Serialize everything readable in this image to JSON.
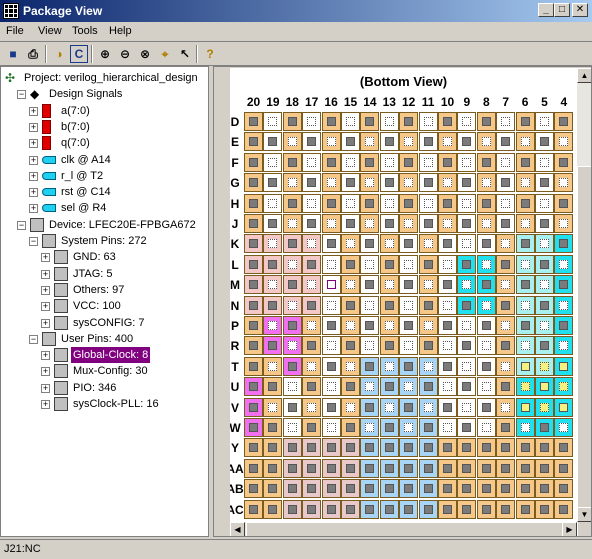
{
  "window": {
    "title": "Package View",
    "minimize_glyph": "_",
    "maximize_glyph": "□",
    "close_glyph": "✕"
  },
  "menu": [
    "File",
    "View",
    "Tools",
    "Help"
  ],
  "toolbar_icons": [
    "save-icon",
    "print-icon",
    "properties-icon",
    "refresh-icon",
    "zoom-in-icon",
    "zoom-out-icon",
    "zoom-fit-icon",
    "find-icon",
    "pointer-icon",
    "help-icon"
  ],
  "toolbar_glyphs": {
    "save-icon": "■",
    "print-icon": "⎙",
    "properties-icon": "◑",
    "refresh-icon": "C",
    "zoom-in-icon": "⊕",
    "zoom-out-icon": "⊖",
    "zoom-fit-icon": "⊗",
    "find-icon": "⌖",
    "pointer-icon": "↖",
    "help-icon": "?"
  },
  "tree": [
    {
      "label": "Project: verilog_hierarchical_design",
      "level": 0,
      "icon": "project-icon",
      "exp": ""
    },
    {
      "label": "Design Signals",
      "level": 1,
      "icon": "signals-icon",
      "exp": "−"
    },
    {
      "label": "a(7:0)",
      "level": 2,
      "icon": "bus-icon",
      "exp": "+"
    },
    {
      "label": "b(7:0)",
      "level": 2,
      "icon": "bus-icon",
      "exp": "+"
    },
    {
      "label": "q(7:0)",
      "level": 2,
      "icon": "bus-icon",
      "exp": "+"
    },
    {
      "label": "clk @ A14",
      "level": 2,
      "icon": "pin-icon",
      "exp": "+"
    },
    {
      "label": "r_l @ T2",
      "level": 2,
      "icon": "pin-icon",
      "exp": "+"
    },
    {
      "label": "rst @ C14",
      "level": 2,
      "icon": "pin-icon",
      "exp": "+"
    },
    {
      "label": "sel @ R4",
      "level": 2,
      "icon": "pin-icon",
      "exp": "+"
    },
    {
      "label": "Device: LFEC20E-FPBGA672",
      "level": 1,
      "icon": "chip-icon",
      "exp": "−"
    },
    {
      "label": "System Pins: 272",
      "level": 2,
      "icon": "chip-icon",
      "exp": "−"
    },
    {
      "label": "GND: 63",
      "level": 3,
      "icon": "chip-icon",
      "exp": "+"
    },
    {
      "label": "JTAG: 5",
      "level": 3,
      "icon": "chip-icon",
      "exp": "+"
    },
    {
      "label": "Others: 97",
      "level": 3,
      "icon": "chip-icon",
      "exp": "+"
    },
    {
      "label": "VCC: 100",
      "level": 3,
      "icon": "chip-icon",
      "exp": "+"
    },
    {
      "label": "sysCONFIG: 7",
      "level": 3,
      "icon": "chip-icon",
      "exp": "+"
    },
    {
      "label": "User Pins: 400",
      "level": 2,
      "icon": "chip-icon",
      "exp": "−"
    },
    {
      "label": "Global-Clock: 8",
      "level": 3,
      "icon": "chip-icon",
      "exp": "+",
      "selected": true
    },
    {
      "label": "Mux-Config: 30",
      "level": 3,
      "icon": "chip-icon",
      "exp": "+"
    },
    {
      "label": "PIO: 346",
      "level": 3,
      "icon": "chip-icon",
      "exp": "+"
    },
    {
      "label": "sysClock-PLL: 16",
      "level": 3,
      "icon": "chip-icon",
      "exp": "+"
    }
  ],
  "package_view": {
    "title": "(Bottom View)",
    "columns": [
      "20",
      "19",
      "18",
      "17",
      "16",
      "15",
      "14",
      "13",
      "12",
      "11",
      "10",
      "9",
      "8",
      "7",
      "6",
      "5",
      "4"
    ],
    "rows": [
      "D",
      "E",
      "F",
      "G",
      "H",
      "J",
      "K",
      "L",
      "M",
      "N",
      "P",
      "R",
      "T",
      "U",
      "V",
      "W",
      "Y",
      "AA",
      "AB",
      "AC"
    ],
    "colors": {
      "orange": "#f5c88a",
      "white": "#ffffff",
      "pink": "#f5c8c8",
      "magenta": "#f070f0",
      "cyan": "#20e0f0",
      "lightcyan": "#a8f0f0",
      "yellow": "#f5f080",
      "blue": "#a8d4f5",
      "rose": "#e8c8c8"
    }
  },
  "status": {
    "text": "J21:NC"
  }
}
